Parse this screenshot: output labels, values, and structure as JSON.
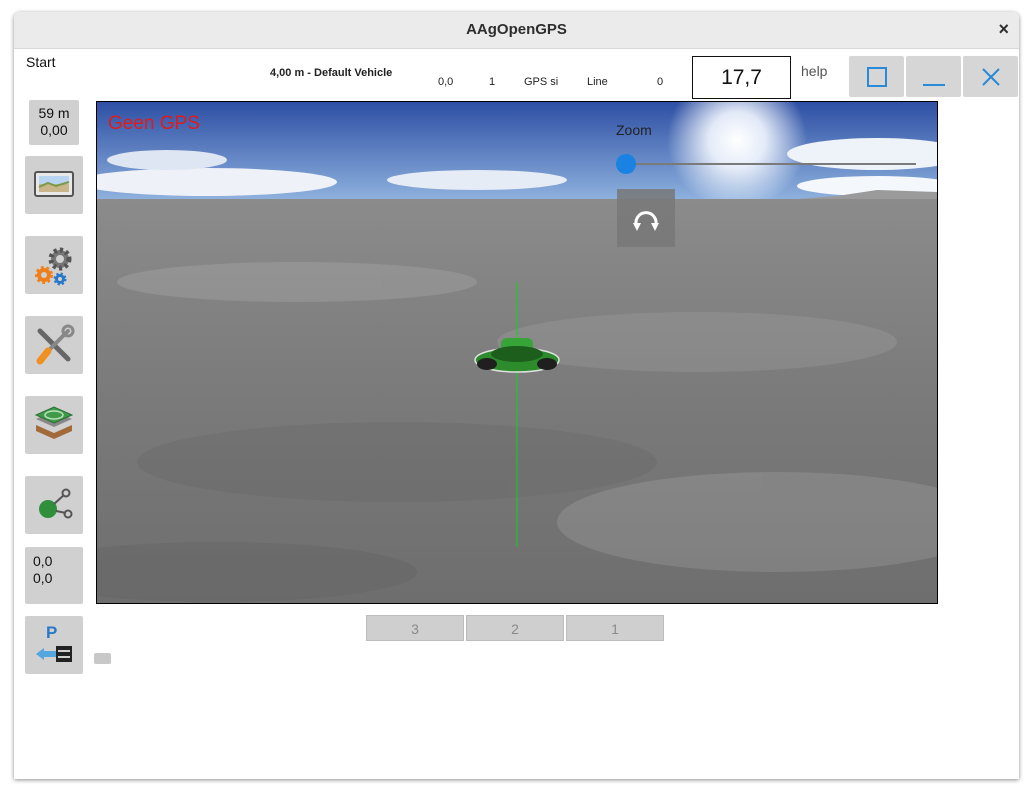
{
  "window": {
    "title": "AAgOpenGPS",
    "close_label": "×"
  },
  "menu": {
    "start_label": "Start"
  },
  "topbar": {
    "vehicle_text": "4,00 m - Default Vehicle",
    "value_a": "0,0",
    "value_b": "1",
    "gps_label": "GPS si",
    "line_label": "Line",
    "value_c": "0",
    "speed_display": "17,7",
    "help_label": "help"
  },
  "sidebar": {
    "distance_top": "59 m",
    "distance_bottom": "0,00",
    "coords_top": "0,0",
    "coords_bottom": "0,0",
    "icons": [
      "field-map-icon",
      "settings-gears-icon",
      "tools-icon",
      "layers-icon",
      "ab-line-icon",
      "parking-icon"
    ]
  },
  "view": {
    "gps_status": "Geen GPS",
    "zoom_label": "Zoom",
    "zoom_level": 0,
    "status_color": "#e01b1b",
    "accent_color": "#1a82e2"
  },
  "tabs": [
    "3",
    "2",
    "1"
  ]
}
